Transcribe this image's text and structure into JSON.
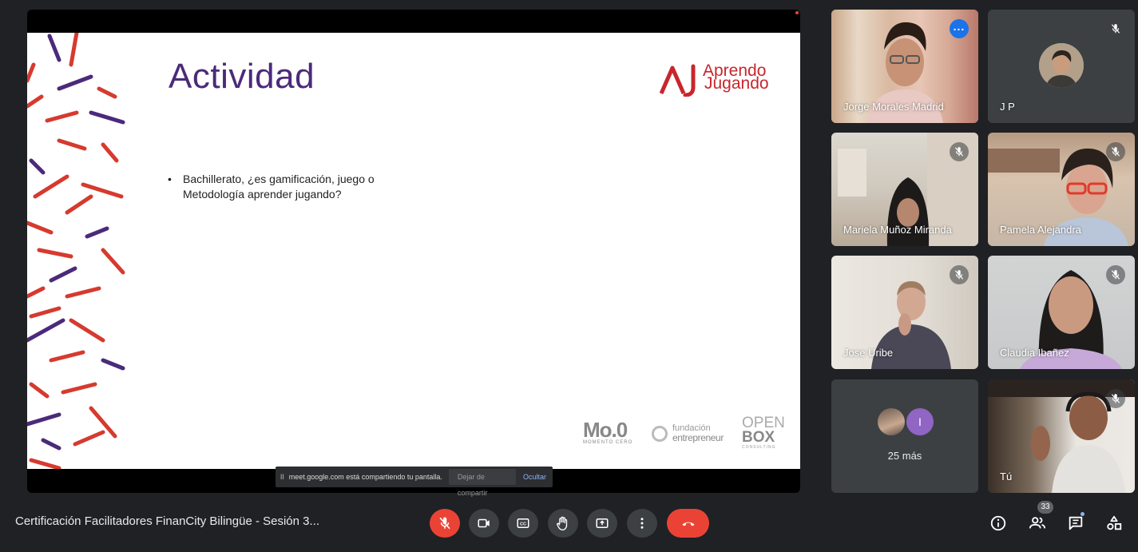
{
  "presentation": {
    "slide_title": "Actividad",
    "brand_line1": "Aprendo",
    "brand_line2": "Jugando",
    "bullet_marker": "•",
    "bullet_text": "Bachillerato, ¿es gamificación, juego o Metodología aprender jugando?",
    "logo_moo": "Mo.0",
    "logo_moo_sub": "MOMENTO CERO",
    "logo_fund_1": "fundación",
    "logo_fund_2": "entrepreneur",
    "logo_open": "OPEN",
    "logo_box": "BOX",
    "logo_consulting": "CONSULTING"
  },
  "share_bar": {
    "pause_icon": "II",
    "message": "meet.google.com está compartiendo tu pantalla.",
    "stop_label": "Dejar de compartir",
    "hide_label": "Ocultar"
  },
  "participants": [
    {
      "name": "Jorge Morales Madrid",
      "muted": false,
      "active": true
    },
    {
      "name": "J P",
      "muted": true
    },
    {
      "name": "Mariela Muñoz Miranda",
      "muted": true
    },
    {
      "name": "Pamela Alejandra",
      "muted": true
    },
    {
      "name": "Jose Uribe",
      "muted": true
    },
    {
      "name": "Claudia Ibañez",
      "muted": true
    },
    {
      "name": "Tú",
      "muted": true
    }
  ],
  "more_tile": {
    "initial": "I",
    "label": "25 más"
  },
  "footer": {
    "meeting_title": "Certificación Facilitadores FinanCity Bilingüe - Sesión 3...",
    "participant_count": "33"
  },
  "colors": {
    "background": "#202124",
    "accent_blue": "#8ab4f8",
    "end_red": "#ea4335",
    "slide_purple": "#4b2a7a",
    "slide_red": "#c8262c"
  },
  "icons": [
    "mic-off-icon",
    "camera-icon",
    "captions-icon",
    "raise-hand-icon",
    "present-icon",
    "more-options-icon",
    "end-call-icon",
    "info-icon",
    "people-icon",
    "chat-icon",
    "activities-icon",
    "more-dots-icon"
  ]
}
